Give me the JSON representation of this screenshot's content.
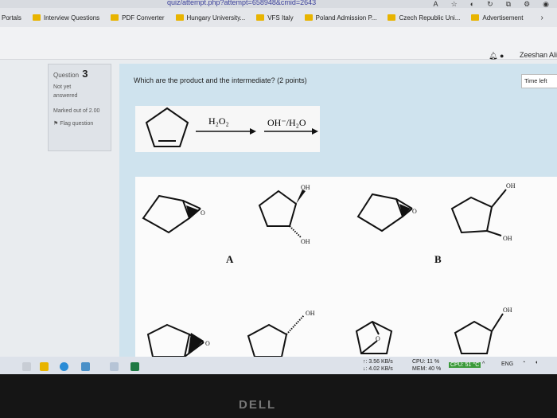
{
  "browser": {
    "url_fragment": "quiz/attempt.php?attempt=658948&cmid=2643"
  },
  "bookmarks": [
    {
      "label": "Portals",
      "folder": false
    },
    {
      "label": "Interview Questions",
      "folder": true
    },
    {
      "label": "PDF Converter",
      "folder": true
    },
    {
      "label": "Hungary University...",
      "folder": true
    },
    {
      "label": "VFS Italy",
      "folder": true
    },
    {
      "label": "Poland Admission P...",
      "folder": true
    },
    {
      "label": "Czech Republic Uni...",
      "folder": true
    },
    {
      "label": "Advertisement",
      "folder": true
    }
  ],
  "user": {
    "name": "Zeeshan Ali"
  },
  "question_info": {
    "label": "Question",
    "number": "3",
    "status": "Not yet answered",
    "marks": "Marked out of 2.00",
    "flag": "Flag question"
  },
  "question": {
    "text": "Which are the product and the intermediate? (2 points)"
  },
  "timer": {
    "label": "Time left"
  },
  "reaction": {
    "reagent1": "H₂O₂",
    "reagent2": "OH⁻/H₂O"
  },
  "answer_labels": {
    "a": "A",
    "b": "B"
  },
  "structures": {
    "oh": "OH",
    "o": "O"
  },
  "system_tray": {
    "net_up": "↑: 3.56 KB/s",
    "net_down": "↓: 4.02 KB/s",
    "cpu": "CPU: 11 %",
    "mem": "MEM: 40 %",
    "cpu_temp": "CPU: 51 °C",
    "lang": "ENG"
  },
  "brand": "DELL"
}
